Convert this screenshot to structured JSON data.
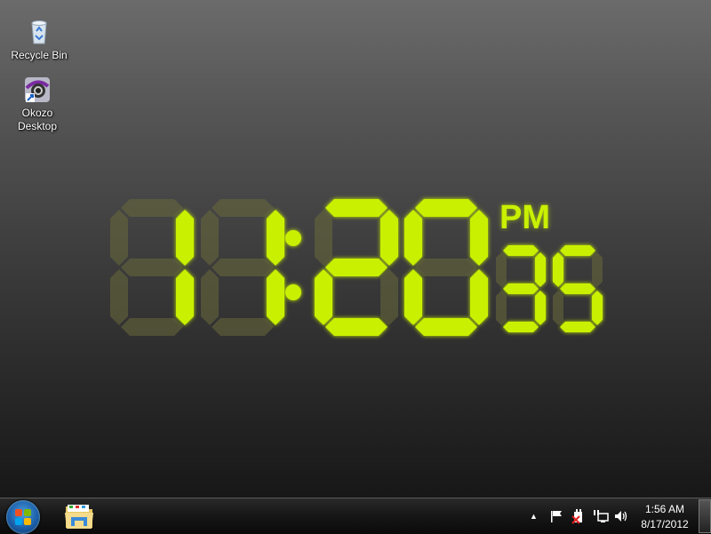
{
  "desktop": {
    "icons": [
      {
        "label": "Recycle Bin",
        "icon": "recycle-bin-icon"
      },
      {
        "label": "Okozo Desktop",
        "label_line1": "Okozo",
        "label_line2": "Desktop",
        "icon": "okozo-desktop-icon"
      }
    ]
  },
  "clock_widget": {
    "hours": "11",
    "minutes": "20",
    "seconds": "35",
    "meridiem": "PM",
    "on_color": "#c8f000",
    "off_color": "#6a6a3c"
  },
  "taskbar": {
    "start_button": "windows-start-orb",
    "pinned": [
      {
        "name": "Windows Explorer",
        "icon": "folder-icon"
      }
    ],
    "tray": {
      "icons": [
        "show-hidden-icons-arrow",
        "action-center-flag-icon",
        "power-unplugged-icon",
        "network-icon",
        "volume-icon"
      ],
      "time": "1:56 AM",
      "date": "8/17/2012"
    }
  }
}
